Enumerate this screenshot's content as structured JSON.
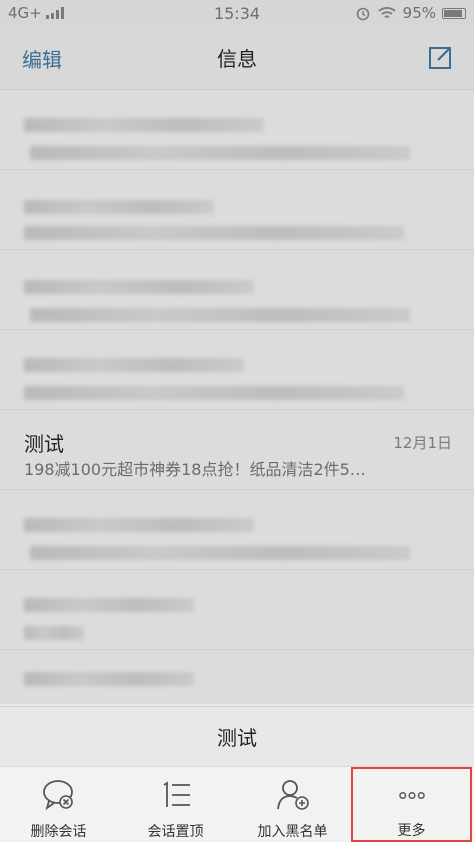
{
  "status_bar": {
    "network": "4G+",
    "time": "15:34",
    "battery": "95%"
  },
  "header": {
    "edit_label": "编辑",
    "title": "信息"
  },
  "conversation": {
    "name": "测试",
    "date": "12月1日",
    "preview": "198减100元超市神券18点抢！纸品清洁2件5…"
  },
  "sheet": {
    "title": "测试",
    "actions": [
      {
        "label": "删除会话",
        "icon": "delete-chat-icon"
      },
      {
        "label": "会话置顶",
        "icon": "pin-top-icon"
      },
      {
        "label": "加入黑名单",
        "icon": "add-blacklist-icon"
      },
      {
        "label": "更多",
        "icon": "more-dots-icon"
      }
    ]
  },
  "colors": {
    "accent": "#3c6e93",
    "highlight_border": "#e0453f"
  }
}
